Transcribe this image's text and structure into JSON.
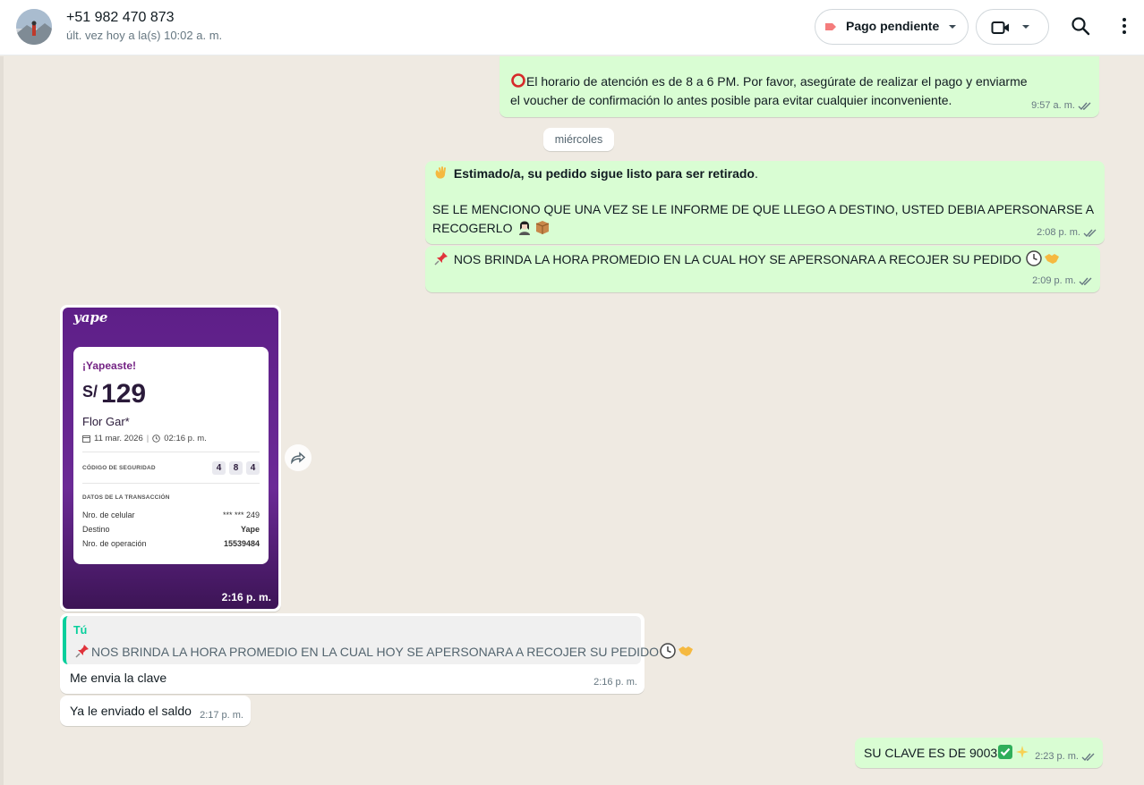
{
  "header": {
    "contact_name": "+51 982 470 873",
    "last_seen": "últ. vez hoy a la(s) 10:02 a. m.",
    "label_button": "Pago pendiente",
    "icons": [
      "avatar",
      "label-tag-icon",
      "video-call-icon",
      "chevron-down-icon",
      "search-icon",
      "menu-icon"
    ]
  },
  "messages": {
    "m1": {
      "text_line1": "El horario de atención es de 8 a 6 PM. Por favor, asegúrate de realizar el pago y enviarme",
      "text_line2": "el voucher de confirmación lo antes posible para evitar cualquier inconveniente.",
      "time": "9:57 a. m."
    },
    "date_divider": "miércoles",
    "m2": {
      "bold": "Estimado/a, su pedido sigue listo para ser retirado",
      "bold_end": ".",
      "line2": " SE LE MENCIONO QUE UNA VEZ SE LE INFORME DE QUE LLEGO A DESTINO, USTED DEBIA APERSONARSE A",
      "line3": "RECOGERLO",
      "time": "2:08 p. m."
    },
    "m3": {
      "text": "NOS BRINDA LA HORA PROMEDIO EN LA CUAL HOY SE APERSONARA A RECOJER SU PEDIDO",
      "time": "2:09 p. m."
    },
    "receipt": {
      "brand": "yape",
      "title": "¡Yapeaste!",
      "currency": "S/",
      "amount": "129",
      "name": "Flor Gar*",
      "date": "11 mar. 2026",
      "time": "02:16 p. m.",
      "security_label": "CÓDIGO DE SEGURIDAD",
      "security_digits": [
        "4",
        "8",
        "4"
      ],
      "data_label": "DATOS DE LA TRANSACCIÓN",
      "rows": [
        {
          "k": "Nro. de celular",
          "v": "*** *** 249"
        },
        {
          "k": "Destino",
          "v": "Yape"
        },
        {
          "k": "Nro. de operación",
          "v": "15539484"
        }
      ],
      "msg_time": "2:16 p. m."
    },
    "m5": {
      "quote_author": "Tú",
      "quote_text": "NOS BRINDA LA HORA PROMEDIO EN LA CUAL HOY SE APERSONARA A RECOJER SU PEDIDO",
      "text": "Me envia la clave",
      "time": "2:16 p. m."
    },
    "m6": {
      "text": "Ya le enviado el saldo",
      "time": "2:17 p. m."
    },
    "m7": {
      "text": "SU CLAVE ES DE 9003",
      "time": "2:23 p. m."
    }
  },
  "colors": {
    "outgoing_bubble": "#d9fdd3",
    "incoming_bubble": "#ffffff",
    "chat_background": "#efeae2",
    "quote_accent": "#06cf9c",
    "yape_purple": "#742384"
  }
}
